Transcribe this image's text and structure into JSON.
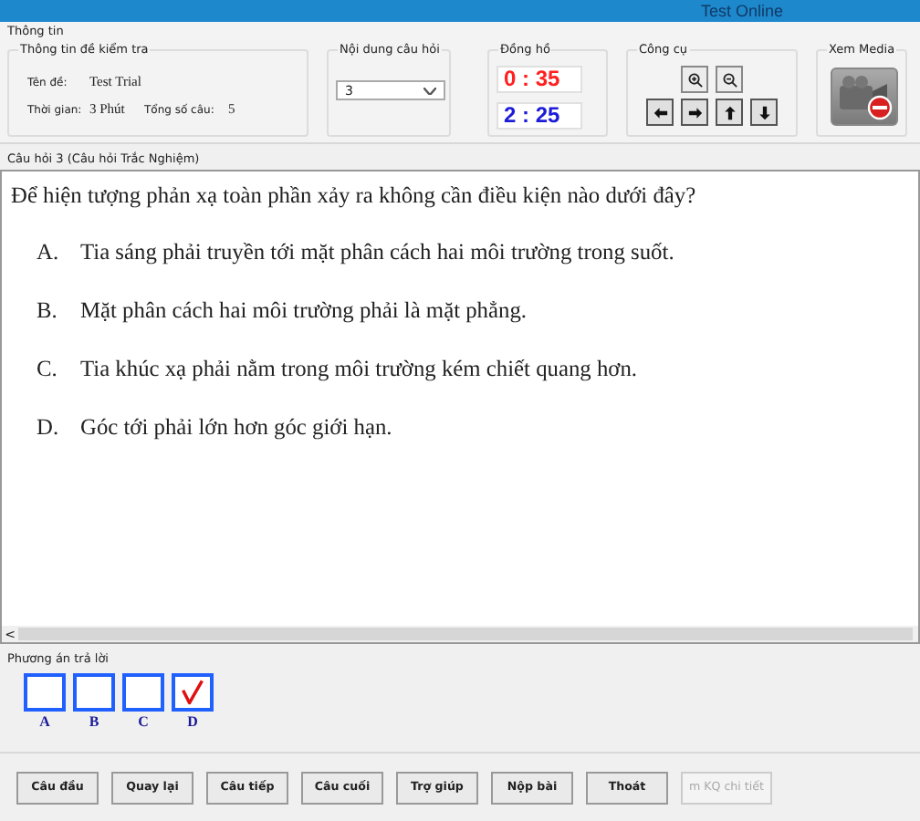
{
  "window": {
    "title": "Test Online"
  },
  "info": {
    "title": "Thông tin",
    "group_title": "Thông tin đề kiểm tra",
    "name_label": "Tên đề:",
    "name": "Test Trial",
    "time_label": "Thời gian:",
    "time": "3 Phút",
    "count_label": "Tổng số câu:",
    "count": "5"
  },
  "question_select": {
    "title": "Nội dung câu hỏi",
    "value": "3"
  },
  "clock": {
    "title": "Đồng hồ",
    "readings": [
      {
        "text": "0 : 35",
        "color": "#ff2020"
      },
      {
        "text": "2 : 25",
        "color": "#1c1cd8"
      }
    ]
  },
  "tools": {
    "title": "Công cụ",
    "buttons": [
      {
        "kind": "zoom-in"
      },
      {
        "kind": "zoom-out"
      },
      {
        "kind": "left"
      },
      {
        "kind": "right"
      },
      {
        "kind": "up"
      },
      {
        "kind": "down"
      }
    ]
  },
  "media": {
    "title": "Xem Media"
  },
  "question": {
    "header": "Câu hỏi 3 (Câu hỏi Trắc Nghiệm)",
    "text": "Để hiện tượng phản xạ toàn phần xảy ra không cần điều kiện nào dưới đây?",
    "options": [
      {
        "letter": "A.",
        "text": "Tia sáng phải truyền tới mặt phân cách hai môi trường trong suốt."
      },
      {
        "letter": "B.",
        "text": "Mặt phân cách hai môi trường phải là mặt phẳng."
      },
      {
        "letter": "C.",
        "text": "Tia khúc xạ phải nằm trong môi trường kém chiết quang hơn."
      },
      {
        "letter": "D.",
        "text": "Góc tới phải lớn hơn góc giới hạn."
      }
    ],
    "scroll_left": "<"
  },
  "answers": {
    "title": "Phương án trả lời",
    "choices": [
      {
        "letter": "A",
        "checked": false
      },
      {
        "letter": "B",
        "checked": false
      },
      {
        "letter": "C",
        "checked": false
      },
      {
        "letter": "D",
        "checked": true
      }
    ]
  },
  "buttons": [
    {
      "label": "Câu đầu",
      "disabled": false
    },
    {
      "label": "Quay lại",
      "disabled": false
    },
    {
      "label": "Câu tiếp",
      "disabled": false
    },
    {
      "label": "Câu cuối",
      "disabled": false
    },
    {
      "label": "Trợ giúp",
      "disabled": false
    },
    {
      "label": "Nộp bài",
      "disabled": false
    },
    {
      "label": "Thoát",
      "disabled": false
    },
    {
      "label": "m KQ chi tiết",
      "disabled": true
    }
  ]
}
